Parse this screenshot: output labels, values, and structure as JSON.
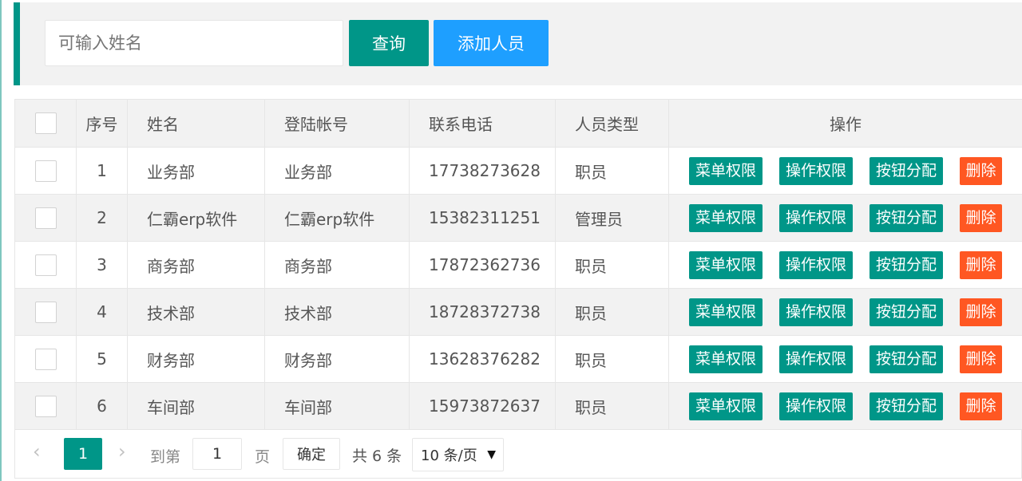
{
  "search": {
    "placeholder": "可输入姓名",
    "query_label": "查询",
    "add_label": "添加人员"
  },
  "table": {
    "headers": {
      "index": "序号",
      "name": "姓名",
      "account": "登陆帐号",
      "phone": "联系电话",
      "type": "人员类型",
      "actions": "操作"
    },
    "action_labels": {
      "menu": "菜单权限",
      "operation": "操作权限",
      "button": "按钮分配",
      "delete": "删除"
    },
    "rows": [
      {
        "index": "1",
        "name": "业务部",
        "account": "业务部",
        "phone": "17738273628",
        "type": "职员"
      },
      {
        "index": "2",
        "name": "仁霸erp软件",
        "account": "仁霸erp软件",
        "phone": "15382311251",
        "type": "管理员"
      },
      {
        "index": "3",
        "name": "商务部",
        "account": "商务部",
        "phone": "17872362736",
        "type": "职员"
      },
      {
        "index": "4",
        "name": "技术部",
        "account": "技术部",
        "phone": "18728372738",
        "type": "职员"
      },
      {
        "index": "5",
        "name": "财务部",
        "account": "财务部",
        "phone": "13628376282",
        "type": "职员"
      },
      {
        "index": "6",
        "name": "车间部",
        "account": "车间部",
        "phone": "15973872637",
        "type": "职员"
      }
    ]
  },
  "pager": {
    "current_page": "1",
    "goto_label": "到第",
    "goto_value": "1",
    "page_label": "页",
    "confirm_label": "确定",
    "total_label": "共 6 条",
    "page_size": "10 条/页",
    "prev_icon": "‹",
    "next_icon": "›"
  },
  "colors": {
    "primary": "#009688",
    "blue": "#1E9FFF",
    "danger": "#FF5722"
  }
}
